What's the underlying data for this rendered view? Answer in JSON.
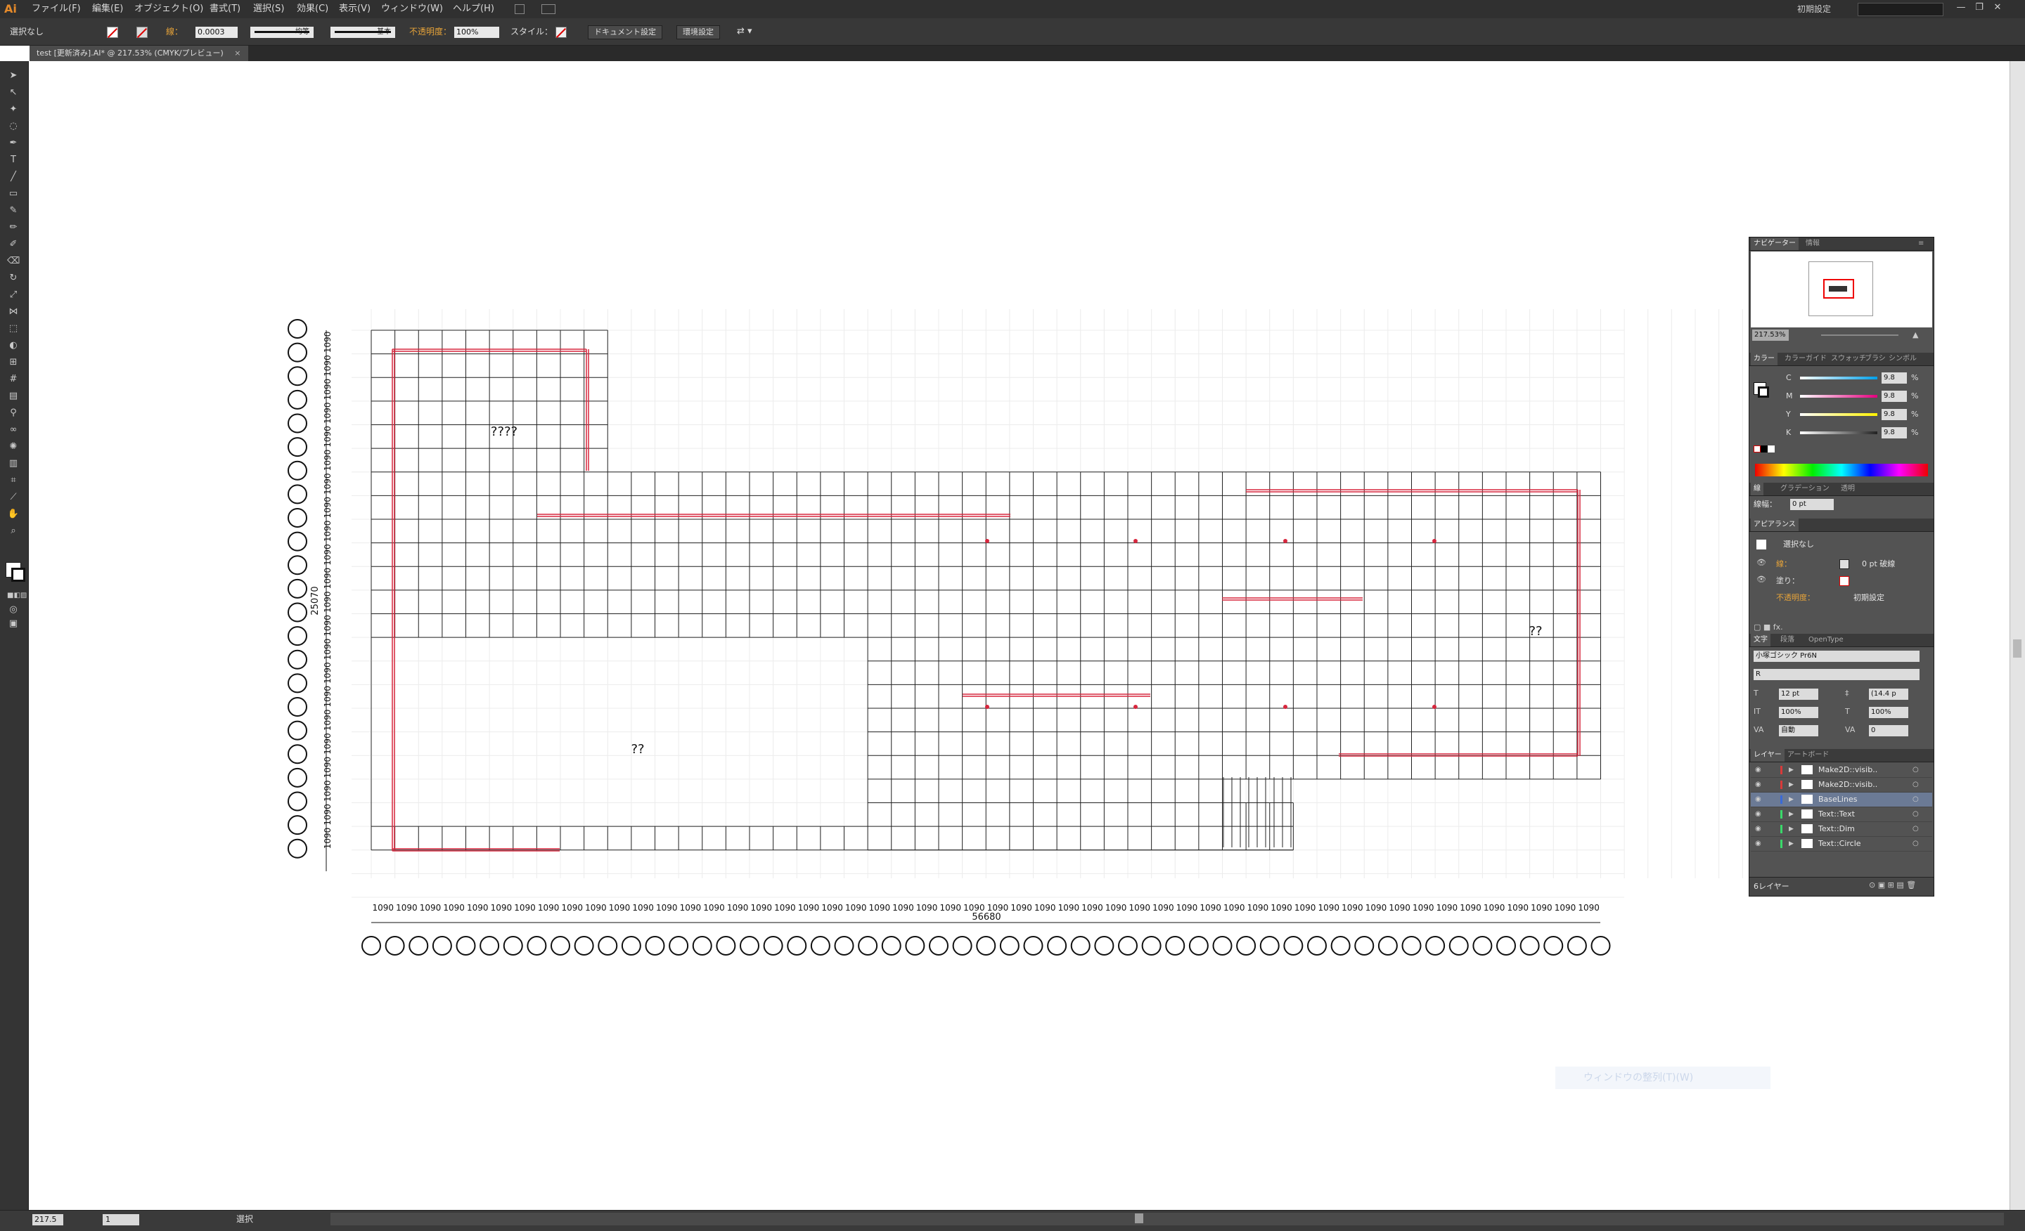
{
  "app": {
    "logo": "Ai"
  },
  "menubar": {
    "items": [
      "ファイル(F)",
      "編集(E)",
      "オブジェクト(O)",
      "書式(T)",
      "選択(S)",
      "効果(C)",
      "表示(V)",
      "ウィンドウ(W)",
      "ヘルプ(H)"
    ],
    "workspace": "初期設定",
    "window_controls": [
      "—",
      "❐",
      "✕"
    ]
  },
  "controlbar": {
    "selection": "選択なし",
    "stroke_label": "線：",
    "stroke_weight": "0.0003",
    "stroke_profile": "均等",
    "brush": "基本",
    "opacity_label": "不透明度：",
    "opacity_value": "100%",
    "style_label": "スタイル：",
    "doc_setup_button": "ドキュメント設定",
    "prefs_button": "環境設定"
  },
  "document_tab": {
    "title": "test [更新済み].AI* @ 217.53% (CMYK/プレビュー)",
    "close": "×"
  },
  "statusbar": {
    "zoom": "217.5",
    "page": "1",
    "tool": "選択"
  },
  "tooltip": {
    "text": "ウィンドウの整列(T)(W)"
  },
  "drawing": {
    "grid_dimension_label": "1090",
    "total_width_label": "56680",
    "total_height_label": "25070",
    "room_label_1": "????",
    "room_label_2": "??",
    "room_label_3": "??"
  },
  "panel": {
    "navigator_tabs": [
      "ナビゲーター",
      "情報"
    ],
    "zoom": "217.53%",
    "color_tabs": [
      "カラー",
      "カラーガイド",
      "スウォッチ",
      "ブラシ",
      "シンボル"
    ],
    "cmyk": [
      {
        "channel": "C",
        "value": "9.8",
        "unit": "%",
        "color": "#00a0e9"
      },
      {
        "channel": "M",
        "value": "9.8",
        "unit": "%",
        "color": "#e4007f"
      },
      {
        "channel": "Y",
        "value": "9.8",
        "unit": "%",
        "color": "#fff100"
      },
      {
        "channel": "K",
        "value": "9.8",
        "unit": "%",
        "color": "#222222"
      }
    ],
    "stroke_tabs": [
      "線",
      "グラデーション",
      "透明"
    ],
    "stroke_weight_label": "線幅：",
    "stroke_weight_value": "0 pt",
    "appearance_title": "アピアランス",
    "appearance_selection": "選択なし",
    "appearance_stroke_label": "線：",
    "appearance_stroke_value": "0 pt 破線",
    "appearance_fill_label": "塗り：",
    "appearance_opacity_label": "不透明度：",
    "appearance_opacity_value": "初期設定",
    "char_tabs": [
      "文字",
      "段落",
      "OpenType"
    ],
    "font_family": "小塚ゴシック Pr6N",
    "font_style": "R",
    "font_size": "12 pt",
    "leading": "(14.4 p",
    "vscale": "100%",
    "hscale": "100%",
    "kerning": "自動",
    "tracking": "0",
    "layer_tabs": [
      "レイヤー",
      "アートボード"
    ],
    "layers": [
      {
        "name": "Make2D::visib..",
        "color": "#d83a3a",
        "selected": false
      },
      {
        "name": "Make2D::visib..",
        "color": "#d83a3a",
        "selected": false
      },
      {
        "name": "BaseLines",
        "color": "#3a6ad8",
        "selected": true
      },
      {
        "name": "Text::Text",
        "color": "#3ad86a",
        "selected": false
      },
      {
        "name": "Text::Dim",
        "color": "#3ad86a",
        "selected": false
      },
      {
        "name": "Text::Circle",
        "color": "#3ad86a",
        "selected": false
      }
    ],
    "layer_count": "6レイヤー"
  }
}
